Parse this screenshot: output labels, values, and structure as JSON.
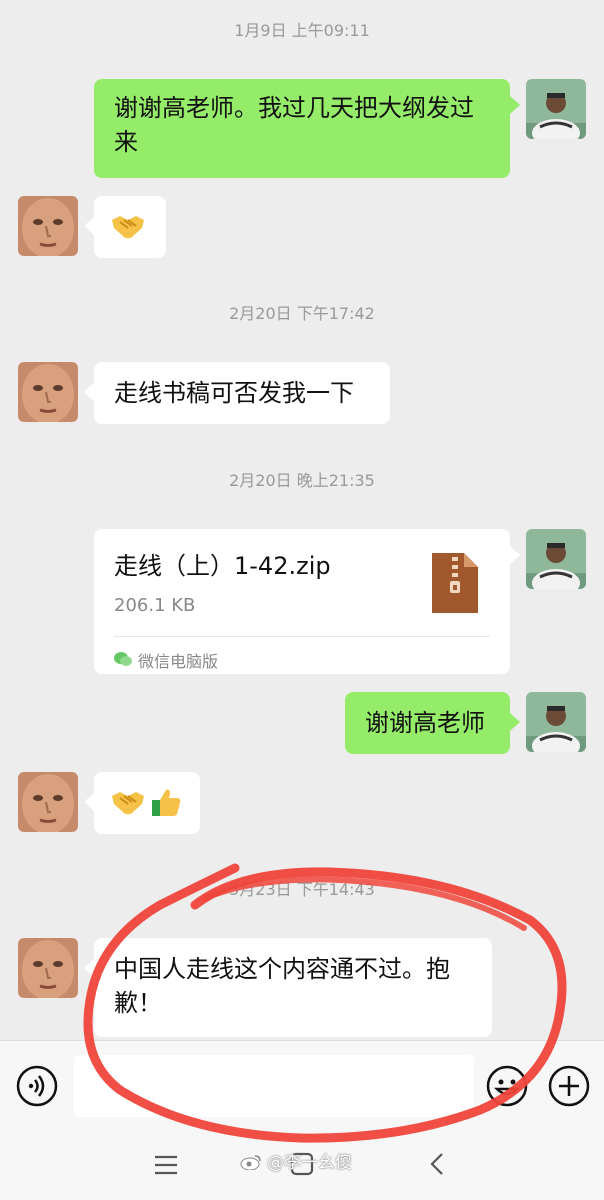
{
  "chat": {
    "messages": [
      {
        "type": "timestamp",
        "text": "1月9日 上午09:11"
      },
      {
        "type": "text",
        "side": "right",
        "text_lines": [
          "谢谢高老师。我过几天把大纲发过",
          "来"
        ]
      },
      {
        "type": "emoji",
        "side": "left",
        "emoji": [
          "handshake"
        ]
      },
      {
        "type": "timestamp",
        "text": "2月20日 下午17:42"
      },
      {
        "type": "text",
        "side": "left",
        "text_lines": [
          "走线书稿可否发我一下"
        ]
      },
      {
        "type": "timestamp",
        "text": "2月20日 晚上21:35"
      },
      {
        "type": "file",
        "side": "right",
        "file_name": "走线（上）1-42.zip",
        "file_size": "206.1 KB",
        "source": "微信电脑版",
        "icon": "zip-file-icon"
      },
      {
        "type": "text",
        "side": "right",
        "text_lines": [
          "谢谢高老师"
        ]
      },
      {
        "type": "emoji",
        "side": "left",
        "emoji": [
          "handshake",
          "thumbs-up"
        ]
      },
      {
        "type": "timestamp",
        "text": "5月23日 下午14:43"
      },
      {
        "type": "text",
        "side": "left",
        "text_lines": [
          "中国人走线这个内容通不过。抱",
          "歉！"
        ]
      }
    ]
  },
  "input_bar": {
    "voice_icon": "voice-icon",
    "text_value": "",
    "emoji_icon": "emoji-face-icon",
    "plus_icon": "plus-icon"
  },
  "nav_bar": {
    "items": [
      "menu-icon",
      "home-icon",
      "back-icon"
    ]
  },
  "watermark": {
    "text": "@李一幺傻"
  },
  "colors": {
    "background": "#ededed",
    "bubble_self": "#95ec69",
    "bubble_other": "#ffffff",
    "annotation": "#f0463c"
  }
}
